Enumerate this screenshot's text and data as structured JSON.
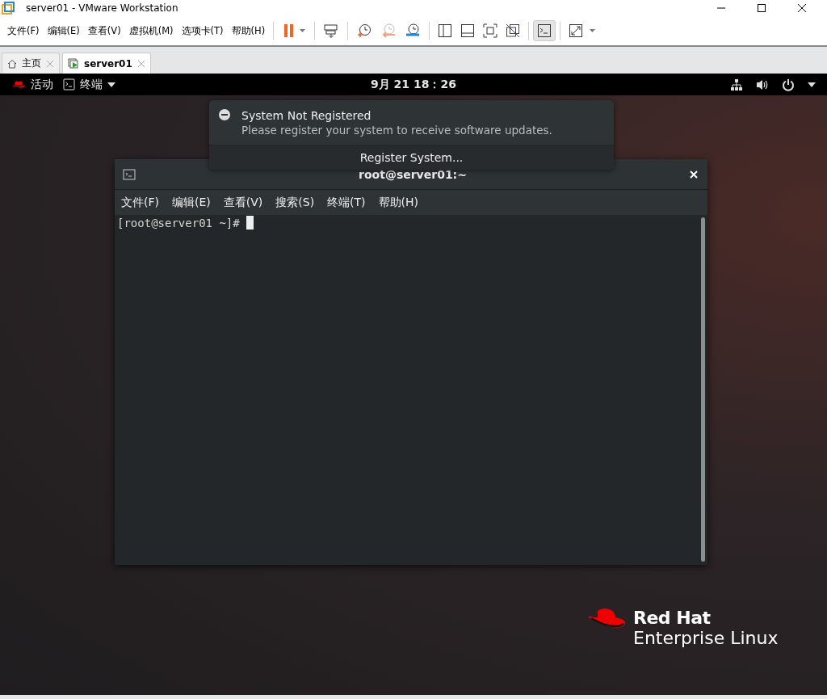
{
  "window": {
    "title": "server01 - VMware Workstation"
  },
  "menu": [
    "文件(F)",
    "编辑(E)",
    "查看(V)",
    "虚拟机(M)",
    "选项卡(T)",
    "帮助(H)"
  ],
  "toolbar": [
    [
      {
        "kind": "pause",
        "selected": false
      }
    ],
    [
      {
        "kind": "send-keys",
        "selected": false
      }
    ],
    [
      {
        "kind": "snapshot",
        "selected": false
      },
      {
        "kind": "revert",
        "selected": false
      },
      {
        "kind": "manage",
        "selected": false
      }
    ],
    [
      {
        "kind": "sidebar",
        "selected": false
      },
      {
        "kind": "thumbnails",
        "selected": false
      },
      {
        "kind": "fullscreen",
        "selected": false
      },
      {
        "kind": "unity",
        "selected": false
      }
    ],
    [
      {
        "kind": "console",
        "selected": true
      }
    ],
    [
      {
        "kind": "stretch",
        "selected": false
      }
    ]
  ],
  "tabs": [
    {
      "label": "主页",
      "kind": "home",
      "selected": false
    },
    {
      "label": "server01",
      "kind": "vm",
      "selected": true
    }
  ],
  "guest": {
    "topbar": {
      "activities": "活动",
      "app": "终端",
      "clock": "9月 21  18：26"
    },
    "notification": {
      "title": "System Not Registered",
      "body": "Please register your system to receive software updates.",
      "action": "Register System..."
    },
    "terminal": {
      "title": "root@server01:~",
      "menu": [
        "文件(F)",
        "编辑(E)",
        "查看(V)",
        "搜索(S)",
        "终端(T)",
        "帮助(H)"
      ],
      "prompt": "[root@server01 ~]# "
    },
    "logo": {
      "line_1": "Red Hat",
      "line_2": "Enterprise Linux"
    }
  }
}
